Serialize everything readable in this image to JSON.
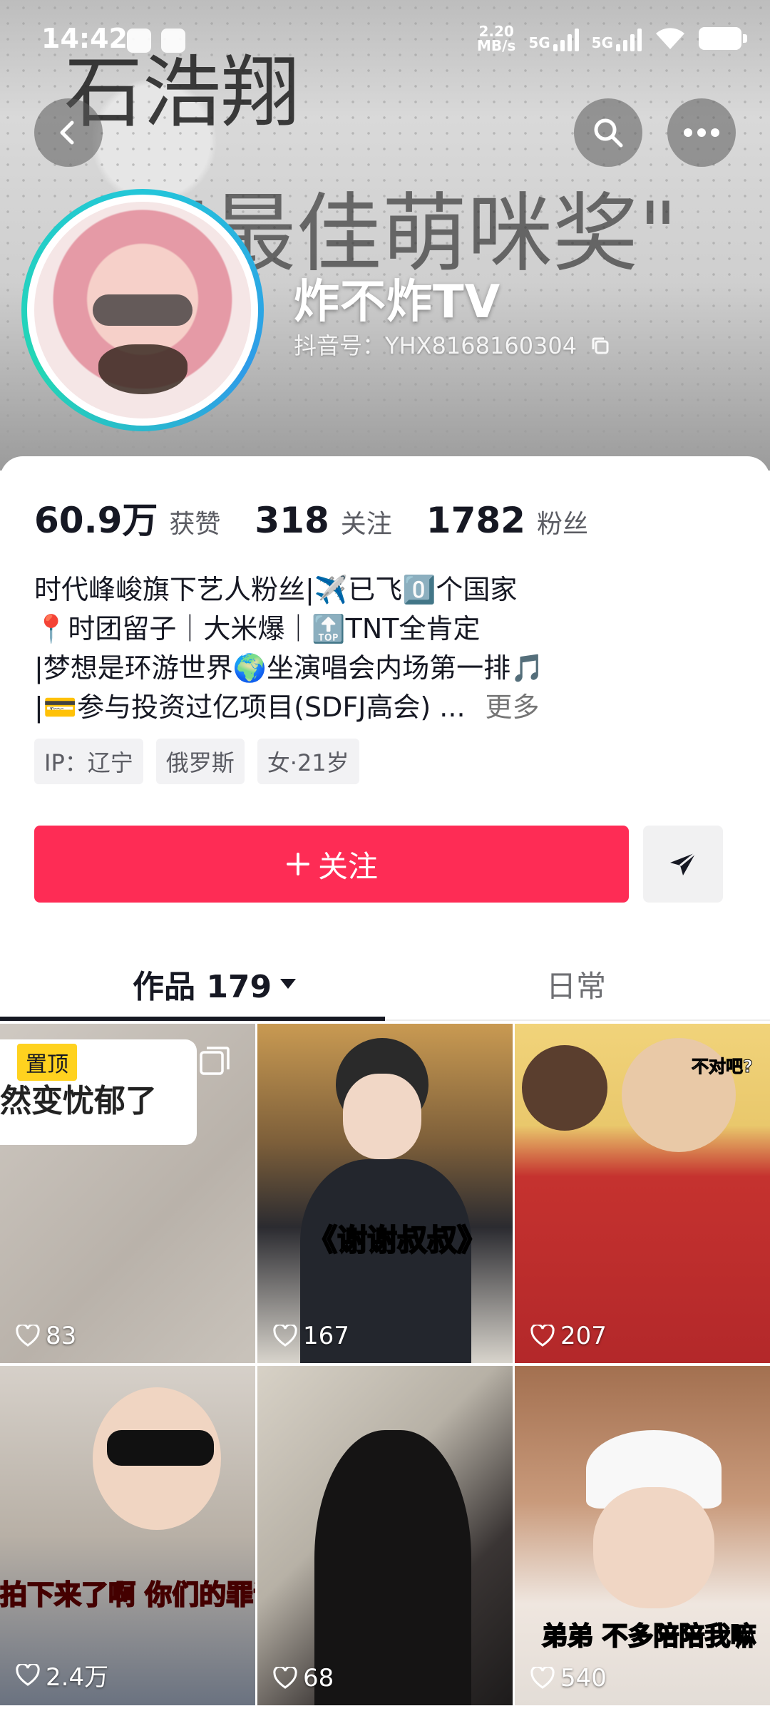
{
  "status": {
    "time": "14:42",
    "net_speed_top": "2.20",
    "net_speed_unit": "MB/s",
    "sim1": "5G",
    "sim2": "5G"
  },
  "banner_scribble": {
    "line1": "石浩翔",
    "line2": "\"最佳萌咪奖\""
  },
  "header": {
    "back_icon": "chevron-left-icon",
    "search_icon": "search-icon",
    "more_icon": "more-icon"
  },
  "profile": {
    "nickname": "炸不炸TV",
    "douyin_id": "抖音号：YHX8168160304"
  },
  "stats": [
    {
      "num": "60.9万",
      "label": "获赞"
    },
    {
      "num": "318",
      "label": "关注"
    },
    {
      "num": "1782",
      "label": "粉丝"
    }
  ],
  "bio": {
    "line1": "时代峰峻旗下艺人粉丝|✈️已飞0️⃣个国家",
    "line2": "📍时团留子｜大米爆｜🔝TNT全肯定",
    "line3": "|梦想是环游世界🌍坐演唱会内场第一排🎵",
    "line4": "|💳参与投资过亿项目(SDFJ高会) ...",
    "more": "更多"
  },
  "tags": [
    "IP：辽宁",
    "俄罗斯",
    "女·21岁"
  ],
  "actions": {
    "follow_label": "关注",
    "follow_icon": "plus-icon",
    "share_icon": "send-icon"
  },
  "tabs": {
    "works": "作品 179",
    "daily": "日常"
  },
  "videos": [
    {
      "likes": "83",
      "pinned_label": "置顶",
      "overlay": "然变忧郁了"
    },
    {
      "likes": "167",
      "overlay": "《谢谢叔叔》"
    },
    {
      "likes": "207",
      "overlay": "不对吧?"
    },
    {
      "likes": "2.4万",
      "overlay": "拍下来了啊 你们的罪证"
    },
    {
      "likes": "68",
      "overlay": ""
    },
    {
      "likes": "540",
      "overlay": "弟弟 不多陪陪我嘛"
    }
  ],
  "colors": {
    "accent": "#fe2c55",
    "pin": "#ffd21f",
    "ring": "#23c6d9"
  }
}
